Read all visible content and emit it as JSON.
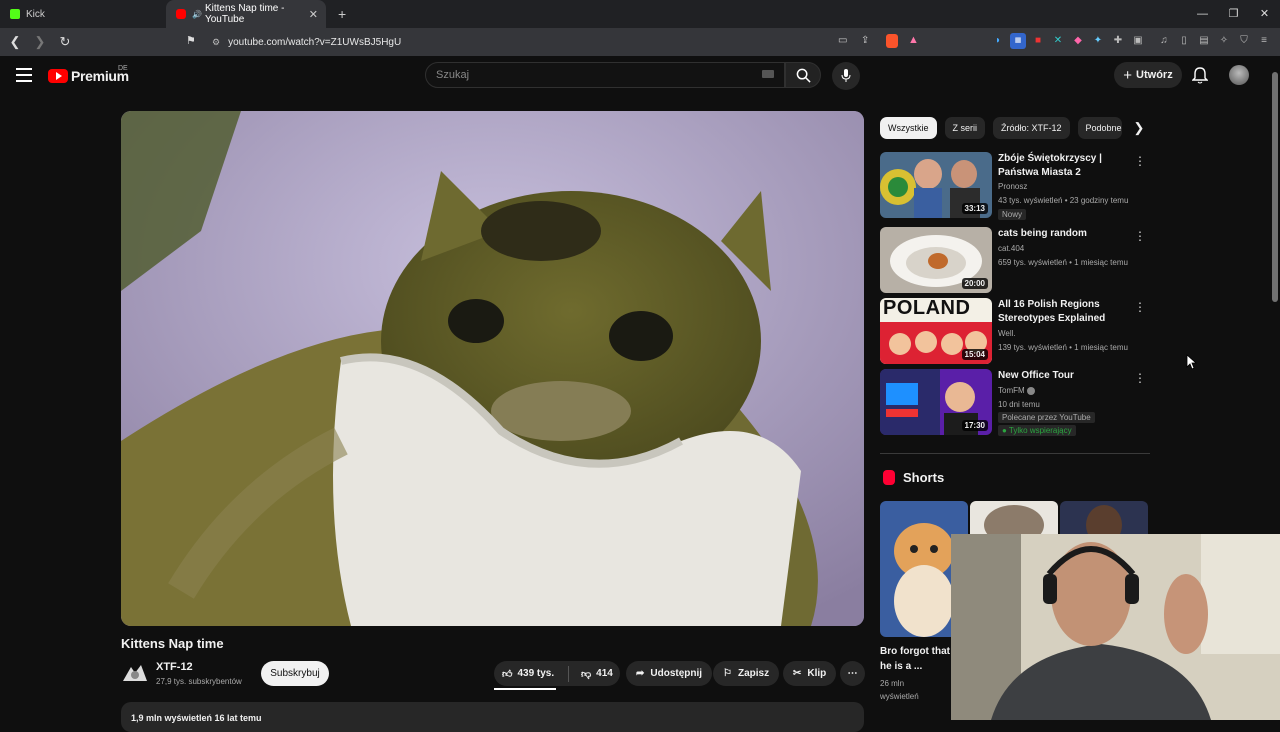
{
  "browser": {
    "tabs": [
      {
        "label": "Kick",
        "active": false
      },
      {
        "label": "Kittens Nap time - YouTube",
        "active": true
      }
    ],
    "url": "youtube.com/watch?v=Z1UWsBJ5HgU"
  },
  "header": {
    "logo": "Premium",
    "region": "DE",
    "search_placeholder": "Szukaj",
    "create_label": "Utwórz"
  },
  "video": {
    "title": "Kittens Nap time",
    "channel": "XTF-12",
    "subscribers": "27,9 tys. subskrybentów",
    "subscribe_label": "Subskrybuj",
    "likes": "439 tys.",
    "dislikes": "414",
    "share_label": "Udostępnij",
    "save_label": "Zapisz",
    "clip_label": "Klip",
    "description_meta": "1,9 mln wyświetleń  16 lat temu"
  },
  "chips": [
    "Wszystkie",
    "Z serii",
    "Źródło: XTF-12",
    "Podobne"
  ],
  "recommendations": [
    {
      "title": "Zbóje Świętokrzyscy | Państwa Miasta 2",
      "channel": "Pronosz",
      "meta": "43 tys. wyświetleń • 23 godziny temu",
      "badge": "Nowy",
      "duration": "33:13"
    },
    {
      "title": "cats being random",
      "channel": "cat.404",
      "meta": "659 tys. wyświetleń • 1 miesiąc temu",
      "duration": "20:00"
    },
    {
      "title": "All 16 Polish Regions Stereotypes Explained",
      "channel": "Well.",
      "meta": "139 tys. wyświetleń • 1 miesiąc temu",
      "thumb_text": "POLAND",
      "duration": "15:04"
    },
    {
      "title": "New Office Tour",
      "channel": "TomFM",
      "meta": "10 dni temu",
      "recommended": "Polecane przez YouTube",
      "members": "Tylko wspierający",
      "duration": "17:30"
    }
  ],
  "shorts": {
    "heading": "Shorts",
    "first_title": "Bro forgot that he is a ...",
    "first_views": "26 mln wyświetleń"
  },
  "colors": {
    "brand": "#ff0000",
    "bg": "#0f0f0f",
    "chip": "#272727"
  }
}
